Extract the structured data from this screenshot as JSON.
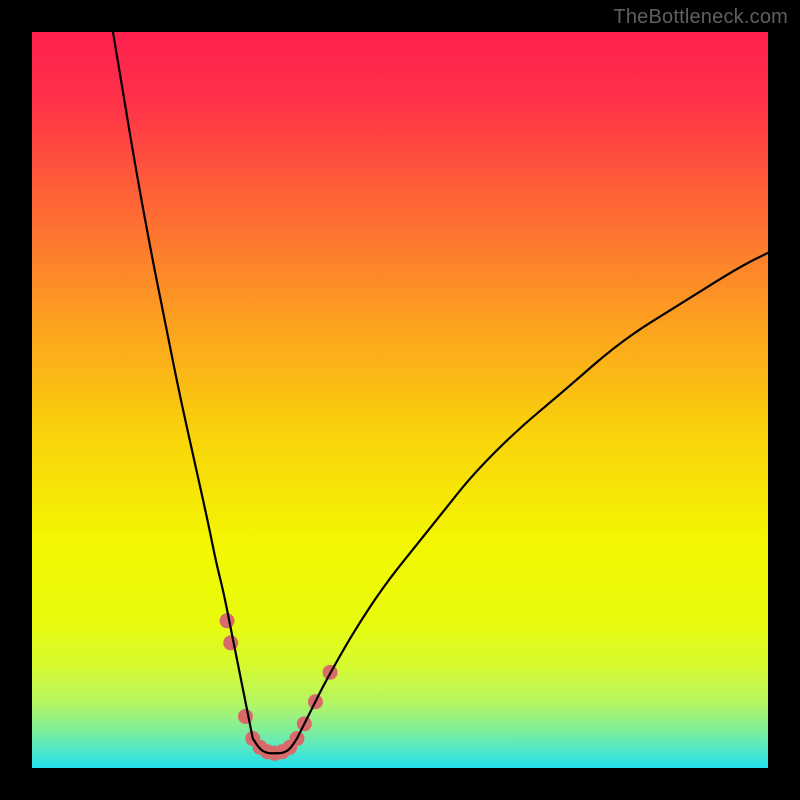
{
  "watermark": "TheBottleneck.com",
  "chart_data": {
    "type": "line",
    "title": "",
    "xlabel": "",
    "ylabel": "",
    "xlim": [
      0,
      100
    ],
    "ylim": [
      0,
      100
    ],
    "grid": false,
    "legend": false,
    "background_gradient_stops": [
      {
        "t": 0.0,
        "color": "#ff1f4e"
      },
      {
        "t": 0.1,
        "color": "#ff3348"
      },
      {
        "t": 0.25,
        "color": "#fe6c33"
      },
      {
        "t": 0.4,
        "color": "#fca21f"
      },
      {
        "t": 0.55,
        "color": "#f9d40a"
      },
      {
        "t": 0.7,
        "color": "#f3f802"
      },
      {
        "t": 0.8,
        "color": "#e8fb0d"
      },
      {
        "t": 0.86,
        "color": "#d7fa2f"
      },
      {
        "t": 0.91,
        "color": "#b6f661"
      },
      {
        "t": 0.95,
        "color": "#7eee9c"
      },
      {
        "t": 0.98,
        "color": "#47e6d0"
      },
      {
        "t": 1.0,
        "color": "#22e0ee"
      }
    ],
    "series": [
      {
        "name": "left-branch",
        "x": [
          11,
          12,
          14,
          16,
          18,
          20,
          22,
          24,
          25,
          26,
          27,
          28,
          29,
          30
        ],
        "y": [
          100,
          94,
          82,
          71,
          61,
          51,
          42,
          33,
          28,
          24,
          19,
          14,
          9,
          4
        ]
      },
      {
        "name": "right-branch",
        "x": [
          36,
          38,
          40,
          44,
          48,
          52,
          56,
          60,
          66,
          72,
          80,
          88,
          96,
          100
        ],
        "y": [
          4,
          8,
          12,
          19,
          25,
          30,
          35,
          40,
          46,
          51,
          58,
          63,
          68,
          70
        ]
      },
      {
        "name": "bottom-connector",
        "x": [
          30,
          31,
          32,
          33,
          34,
          35,
          36
        ],
        "y": [
          4,
          2.5,
          2,
          2,
          2,
          2.5,
          4
        ]
      }
    ],
    "markers": [
      {
        "name": "left-marker-cluster",
        "points": [
          {
            "x": 26.5,
            "y": 20
          },
          {
            "x": 27.0,
            "y": 17
          },
          {
            "x": 29.0,
            "y": 7
          },
          {
            "x": 30.0,
            "y": 4
          },
          {
            "x": 31.0,
            "y": 2.8
          },
          {
            "x": 32.0,
            "y": 2.2
          },
          {
            "x": 33.0,
            "y": 2.0
          },
          {
            "x": 34.0,
            "y": 2.2
          },
          {
            "x": 35.0,
            "y": 2.8
          },
          {
            "x": 36.0,
            "y": 4
          },
          {
            "x": 37.0,
            "y": 6
          },
          {
            "x": 38.5,
            "y": 9
          },
          {
            "x": 40.5,
            "y": 13
          }
        ],
        "color": "#d86a6a",
        "radius": 7.5
      }
    ]
  }
}
